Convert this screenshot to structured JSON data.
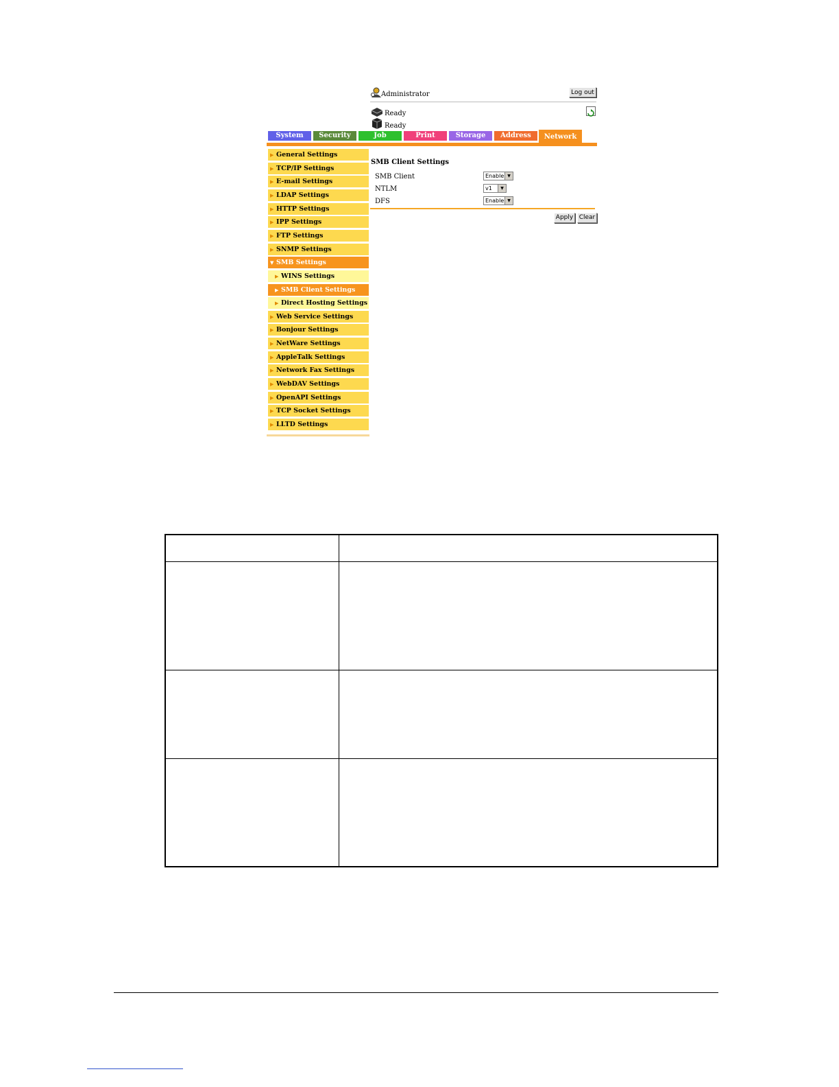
{
  "header": {
    "user_label": "Administrator",
    "logout_label": "Log out",
    "devices": [
      {
        "status": "Ready"
      },
      {
        "status": "Ready"
      }
    ]
  },
  "tabs": [
    {
      "label": "System",
      "color": "#6060e8"
    },
    {
      "label": "Security",
      "color": "#5a8a3a"
    },
    {
      "label": "Job",
      "color": "#2ec02e"
    },
    {
      "label": "Print",
      "color": "#f0407a"
    },
    {
      "label": "Storage",
      "color": "#9966e6"
    },
    {
      "label": "Address",
      "color": "#f06c2e"
    },
    {
      "label": "Network",
      "color": "#f5901e",
      "active": true
    }
  ],
  "sidebar": {
    "items": [
      {
        "label": "General Settings"
      },
      {
        "label": "TCP/IP Settings"
      },
      {
        "label": "E-mail Settings"
      },
      {
        "label": "LDAP Settings"
      },
      {
        "label": "HTTP Settings"
      },
      {
        "label": "IPP Settings"
      },
      {
        "label": "FTP Settings"
      },
      {
        "label": "SNMP Settings"
      },
      {
        "label": "SMB Settings",
        "expanded": true
      },
      {
        "label": "WINS Settings",
        "sub": true
      },
      {
        "label": "SMB Client Settings",
        "sub": true,
        "selected": true
      },
      {
        "label": "Direct Hosting Settings",
        "sub": true
      },
      {
        "label": "Web Service Settings"
      },
      {
        "label": "Bonjour Settings"
      },
      {
        "label": "NetWare Settings"
      },
      {
        "label": "AppleTalk Settings"
      },
      {
        "label": "Network Fax Settings"
      },
      {
        "label": "WebDAV Settings"
      },
      {
        "label": "OpenAPI Settings"
      },
      {
        "label": "TCP Socket Settings"
      },
      {
        "label": "LLTD Settings"
      }
    ]
  },
  "content": {
    "title": "SMB Client Settings",
    "fields": [
      {
        "label": "SMB Client",
        "value": "Enable"
      },
      {
        "label": "NTLM",
        "value": "v1"
      },
      {
        "label": "DFS",
        "value": "Enable"
      }
    ],
    "apply_label": "Apply",
    "clear_label": "Clear"
  }
}
